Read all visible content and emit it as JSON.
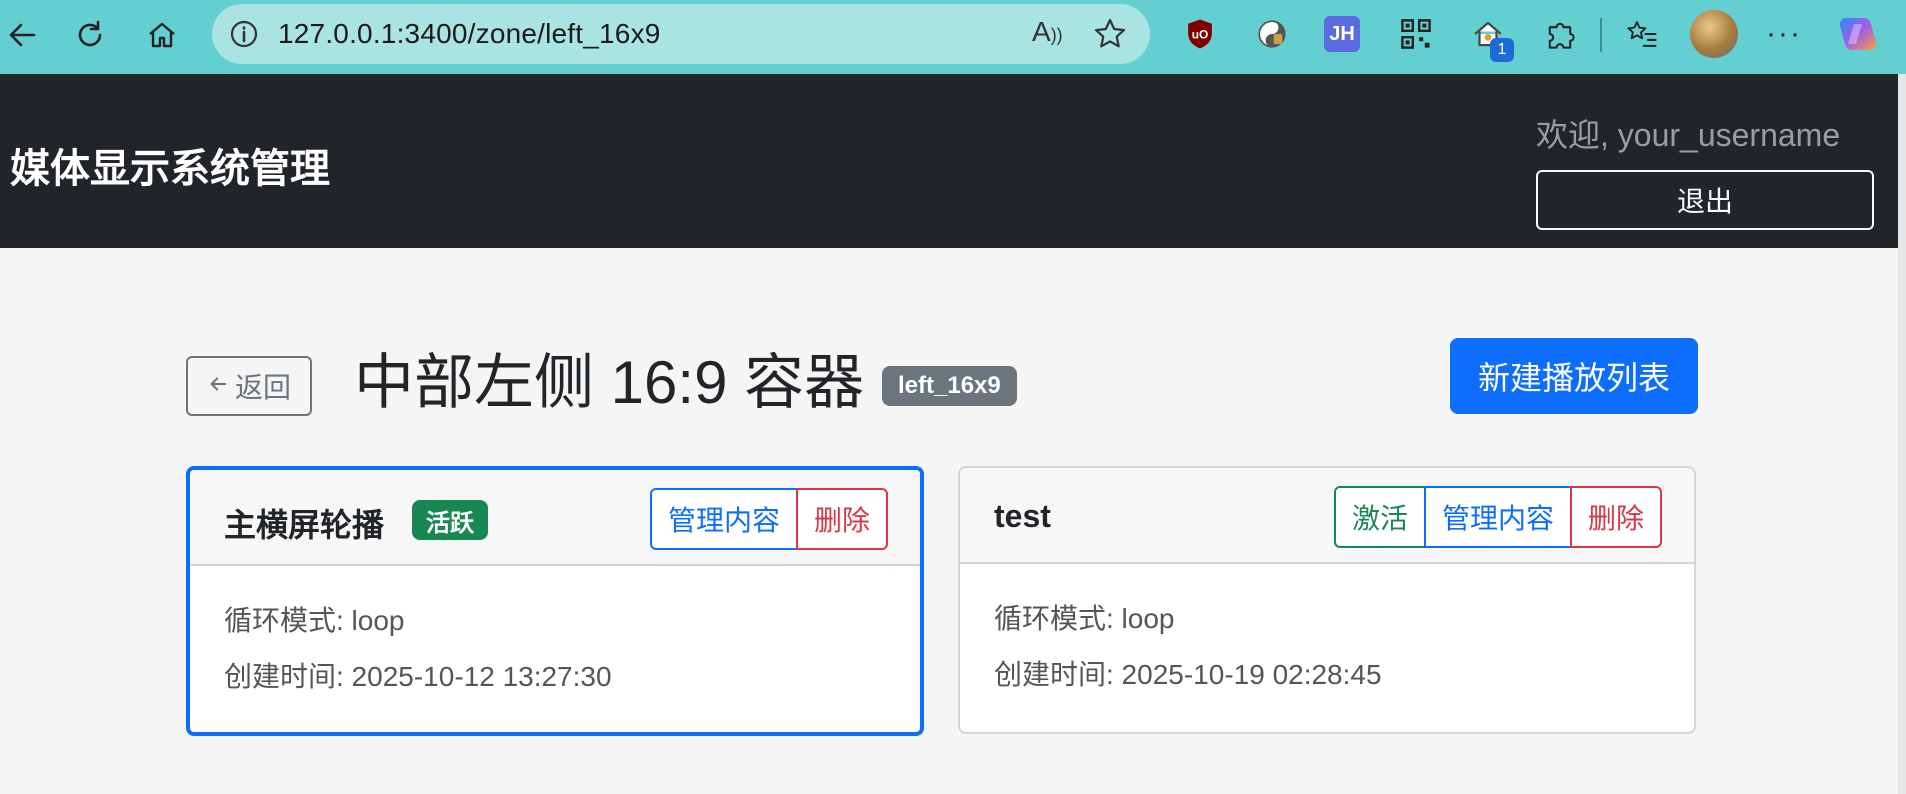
{
  "browser": {
    "url": "127.0.0.1:3400/zone/left_16x9",
    "extension_badge": "1",
    "ext_label": "JH"
  },
  "navbar": {
    "brand": "媒体显示系统管理",
    "welcome": "欢迎, your_username",
    "logout_label": "退出"
  },
  "header": {
    "back_label": "返回",
    "title": "中部左侧 16:9 容器",
    "zone_code": "left_16x9",
    "new_playlist_label": "新建播放列表"
  },
  "playlists": [
    {
      "name": "主横屏轮播",
      "status_badge": "活跃",
      "manage_label": "管理内容",
      "delete_label": "删除",
      "loop_line": "循环模式: loop",
      "created_line": "创建时间: 2025-10-12 13:27:30"
    },
    {
      "name": "test",
      "activate_label": "激活",
      "manage_label": "管理内容",
      "delete_label": "删除",
      "loop_line": "循环模式: loop",
      "created_line": "创建时间: 2025-10-19 02:28:45"
    }
  ],
  "colors": {
    "primary": "#0d6efd",
    "success": "#198754",
    "danger": "#dc3545",
    "secondary": "#6c757d",
    "navbar": "#212529",
    "browser_bar": "#64cfd0"
  }
}
